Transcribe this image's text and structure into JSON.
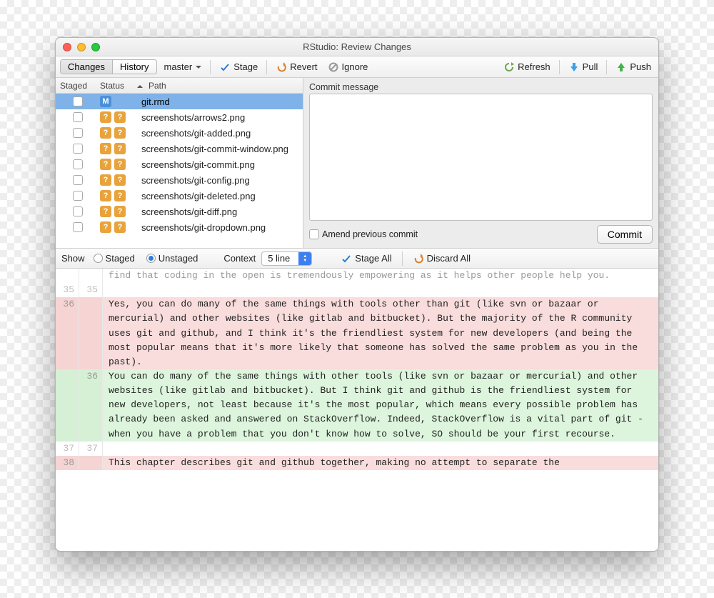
{
  "window": {
    "title": "RStudio: Review Changes"
  },
  "toolbar": {
    "tabs": {
      "changes": "Changes",
      "history": "History",
      "active": "changes"
    },
    "branch": "master",
    "stage": "Stage",
    "revert": "Revert",
    "ignore": "Ignore",
    "refresh": "Refresh",
    "pull": "Pull",
    "push": "Push"
  },
  "files": {
    "headers": {
      "staged": "Staged",
      "status": "Status",
      "path": "Path"
    },
    "rows": [
      {
        "path": "git.rmd",
        "status": [
          "M"
        ],
        "selected": true
      },
      {
        "path": "screenshots/arrows2.png",
        "status": [
          "?",
          "?"
        ]
      },
      {
        "path": "screenshots/git-added.png",
        "status": [
          "?",
          "?"
        ]
      },
      {
        "path": "screenshots/git-commit-window.png",
        "status": [
          "?",
          "?"
        ]
      },
      {
        "path": "screenshots/git-commit.png",
        "status": [
          "?",
          "?"
        ]
      },
      {
        "path": "screenshots/git-config.png",
        "status": [
          "?",
          "?"
        ]
      },
      {
        "path": "screenshots/git-deleted.png",
        "status": [
          "?",
          "?"
        ]
      },
      {
        "path": "screenshots/git-diff.png",
        "status": [
          "?",
          "?"
        ]
      },
      {
        "path": "screenshots/git-dropdown.png",
        "status": [
          "?",
          "?"
        ]
      }
    ]
  },
  "commit": {
    "label": "Commit message",
    "value": "",
    "amend_label": "Amend previous commit",
    "button": "Commit"
  },
  "diffbar": {
    "show": "Show",
    "staged": "Staged",
    "unstaged": "Unstaged",
    "selected": "unstaged",
    "context": "Context",
    "context_value": "5 line",
    "stage_all": "Stage All",
    "discard_all": "Discard All"
  },
  "diff": {
    "rows": [
      {
        "type": "ctx",
        "old": "",
        "new": "",
        "text": "find that coding in the open is tremendously empowering as it helps other people help you."
      },
      {
        "type": "ctx",
        "old": "35",
        "new": "35",
        "text": ""
      },
      {
        "type": "del",
        "old": "36",
        "new": "",
        "text": "Yes, you can do many of the same things with tools other than git (like svn or bazaar or mercurial) and other websites (like gitlab and bitbucket). But the majority of the R community uses git and github, and I think it's the friendliest system for new developers (and being the most popular means that it's more likely that someone has solved the same problem as you in the past)."
      },
      {
        "type": "add",
        "old": "",
        "new": "36",
        "text": "You can do many of the same things with other tools (like svn or bazaar or mercurial) and other websites (like gitlab and bitbucket). But I think git and github is the friendliest system for new developers, not least because it's the most popular, which means every possible problem has already been asked and answered on StackOverflow. Indeed, StackOverflow is a vital part of git - when you have a problem that you don't know how to solve, SO should be your first recourse."
      },
      {
        "type": "ctx",
        "old": "37",
        "new": "37",
        "text": ""
      },
      {
        "type": "del",
        "old": "38",
        "new": "",
        "text": "This chapter describes git and github together, making no attempt to separate the"
      }
    ]
  }
}
